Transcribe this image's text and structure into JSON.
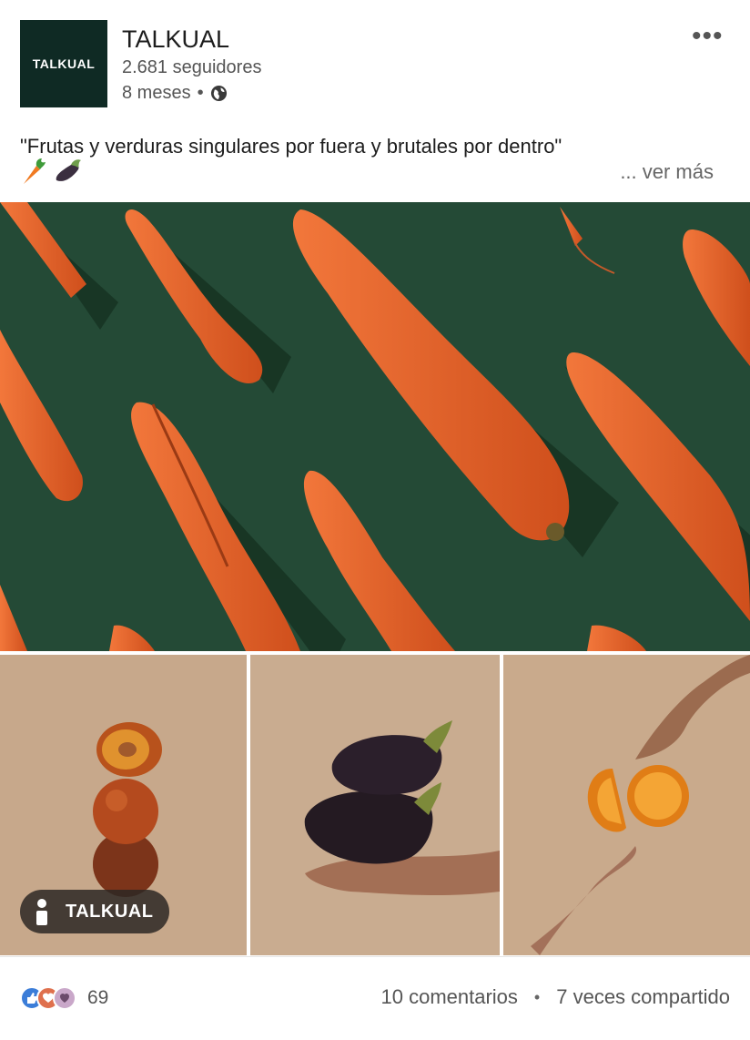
{
  "post": {
    "author": {
      "logo_text": "TALKUAL",
      "name": "TALKUAL",
      "followers": "2.681 seguidores",
      "time": "8 meses",
      "separator": "•",
      "visibility_icon": "globe-icon"
    },
    "more_menu_icon": "more-dots-icon",
    "caption": "\"Frutas y verduras singulares por fuera y brutales por dentro\"",
    "caption_emojis": [
      "carrot-emoji",
      "eggplant-emoji"
    ],
    "see_more": "... ver más",
    "images": {
      "hero_subject": "carrots-on-green",
      "tile1_subject": "stacked-stone-fruits",
      "tile2_subject": "eggplants-in-hand",
      "tile3_subject": "orange-halves-between-hands",
      "tagged_badge": "TALKUAL"
    }
  },
  "footer": {
    "reaction_icons": [
      "like-icon",
      "love-icon",
      "support-icon"
    ],
    "reaction_count": "69",
    "comments": "10 comentarios",
    "separator": "•",
    "shares": "7 veces compartido"
  },
  "colors": {
    "logo_bg": "#0f2a24",
    "hero_bg": "#244a36",
    "carrot": "#e0602a",
    "tile_bg": "#c7a88b"
  }
}
